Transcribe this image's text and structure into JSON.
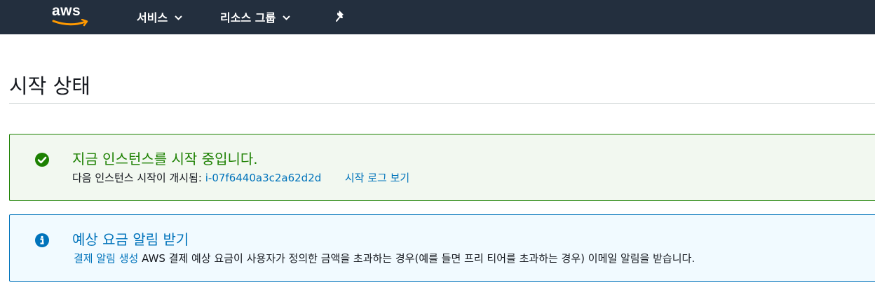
{
  "nav": {
    "logo": "aws",
    "services_label": "서비스",
    "resource_groups_label": "리소스 그룹",
    "icons": {
      "services_chevron": "chevron-down-icon",
      "groups_chevron": "chevron-down-icon",
      "pin": "pin-icon"
    }
  },
  "page": {
    "title": "시작 상태"
  },
  "success_alert": {
    "icon": "check-circle-icon",
    "title": "지금 인스턴스를 시작 중입니다.",
    "body_prefix": "다음 인스턴스 시작이 개시됨:",
    "instance_id": "i-07f6440a3c2a62d2d",
    "log_link": "시작 로그 보기",
    "color": "#1d8102"
  },
  "info_alert": {
    "icon": "info-circle-icon",
    "title": "예상 요금 알림 받기",
    "link": "결제 알림 생성",
    "body": "AWS 결제 예상 요금이 사용자가 정의한 금액을 초과하는 경우(예를 들면 프리 티어를 초과하는 경우) 이메일 알림을 받습니다.",
    "color": "#0073bb"
  },
  "colors": {
    "nav_bg": "#232f3e",
    "aws_orange": "#ff9900",
    "link": "#0073bb"
  }
}
